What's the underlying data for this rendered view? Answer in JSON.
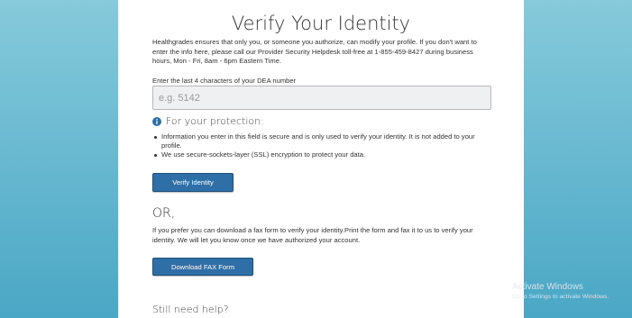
{
  "title": "Verify Your Identity",
  "intro": "Healthgrades ensures that only you, or someone you authorize, can modify your profile. If you don't want to enter the info here, please call our Provider Security Helpdesk toll-free at 1-855-459-8427 during business hours, Mon - Fri, 8am - 6pm Eastern Time.",
  "dea": {
    "label": "Enter the last 4 characters of your DEA number",
    "placeholder": "e.g. 5142",
    "value": ""
  },
  "protection": {
    "heading": "For your protection:",
    "icon": "info-icon",
    "bullets": [
      "Information you enter in this field is secure and is only used to verify your identity.  It is not added to your profile.",
      "We use secure-sockets-layer (SSL) encryption to protect your data."
    ]
  },
  "verify_button": "Verify Identity",
  "or_label": "OR,",
  "fax_text": "If you prefer you can download a fax form to verify your identity.Print the form and fax it to us to verify your identity. We will let you know once we have authorized your account.",
  "fax_button": "Download FAX Form",
  "help_heading": "Still need help?",
  "watermark": {
    "title": "Activate Windows",
    "subtitle": "Go to Settings to activate Windows."
  },
  "colors": {
    "button": "#2f6fa7",
    "background_top": "#86cadb",
    "background_bottom": "#4aa7c5",
    "info_icon": "#2f6fa7"
  }
}
